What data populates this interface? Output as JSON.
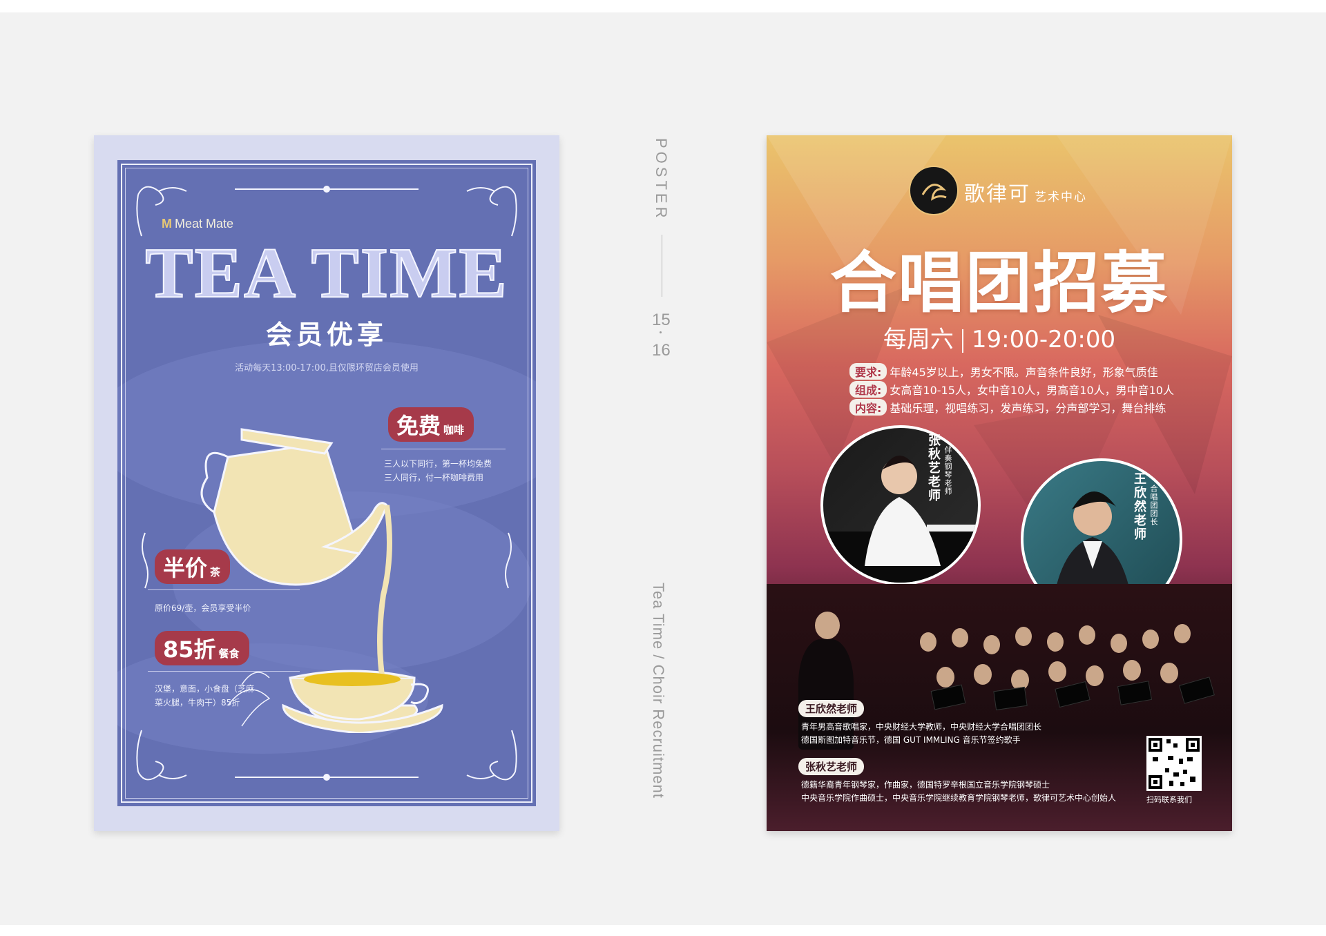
{
  "colors": {
    "background": "#f2f2f2",
    "tea_poster_bg": "#6470b3",
    "tea_poster_border": "#d8dbf0",
    "tea_accent_red": "#a63a4a",
    "tea_cream": "#f2e4b4",
    "choir_gradient_top": "#eac46c",
    "choir_gradient_mid": "#b84f5a",
    "choir_gradient_bottom": "#2a1016"
  },
  "tea_poster": {
    "brand": "Meat Mate",
    "title": "TEA TIME",
    "subtitle": "会员优享",
    "note": "活动每天13:00-17:00,且仅限环贸店会员使用",
    "free": {
      "label": "免费",
      "small": "咖啡",
      "lines": [
        "三人以下同行，第一杯均免费",
        "三人同行，付一杯咖啡费用"
      ]
    },
    "half": {
      "label": "半价",
      "small": "茶",
      "line": "原价69/壶，会员享受半价"
    },
    "discount": {
      "label": "85折",
      "small": "餐食",
      "lines": [
        "汉堡，意面，小食盘（芝麻",
        "菜火腿，牛肉干）85折"
      ]
    }
  },
  "center": {
    "label": "POSTER",
    "page_current": "15",
    "page_next": "16",
    "caption": "Tea Time / Choir Recruitment"
  },
  "choir_poster": {
    "brand": "歌律可",
    "brand_sub": "艺术中心",
    "title": "合唱团招募",
    "time_day": "每周六",
    "time_range": "19:00-20:00",
    "requirements": [
      {
        "tag": "要求:",
        "text": "年龄45岁以上，男女不限。声音条件良好，形象气质佳"
      },
      {
        "tag": "组成:",
        "text": "女高音10-15人，女中音10人，男高音10人，男中音10人"
      },
      {
        "tag": "内容:",
        "text": "基础乐理，视唱练习，发声练习，分声部学习，舞台排练"
      }
    ],
    "teacher1": {
      "name": "张秋艺老师",
      "role": "伴奏钢琴老师"
    },
    "teacher2": {
      "name": "王欣然老师",
      "role": "合唱团团长"
    },
    "bio1": {
      "name": "王欣然老师",
      "lines": [
        "青年男高音歌唱家，中央财经大学教师，中央财经大学合唱团团长",
        "德国斯图加特音乐节，德国 GUT IMMLING 音乐节签约歌手"
      ]
    },
    "bio2": {
      "name": "张秋艺老师",
      "lines": [
        "德籍华裔青年钢琴家，作曲家，德国特罗辛根国立音乐学院钢琴硕士",
        "中央音乐学院作曲硕士，中央音乐学院继续教育学院钢琴老师，歌律可艺术中心创始人"
      ]
    },
    "qr_caption": "扫码联系我们"
  }
}
